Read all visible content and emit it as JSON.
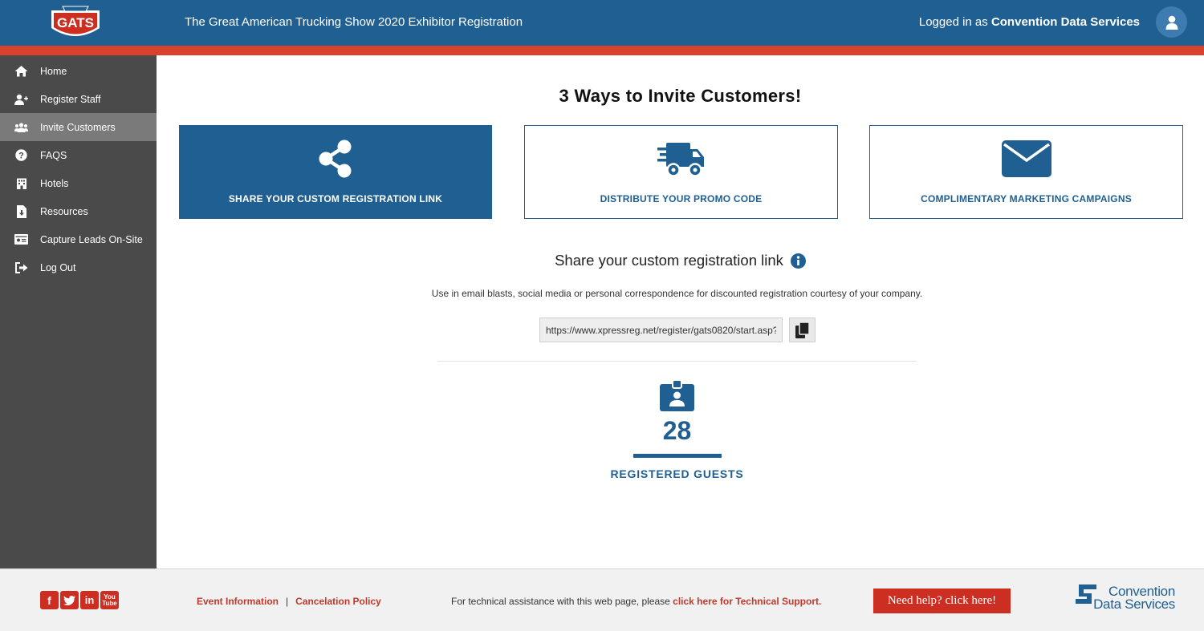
{
  "header": {
    "logo_text": "GATS",
    "title": "The Great American Trucking Show 2020 Exhibitor Registration",
    "logged_in_prefix": "Logged in as",
    "user_name": "Convention Data Services"
  },
  "sidebar": {
    "items": [
      {
        "label": "Home",
        "icon": "home-icon"
      },
      {
        "label": "Register Staff",
        "icon": "user-plus-icon"
      },
      {
        "label": "Invite Customers",
        "icon": "users-icon",
        "active": true
      },
      {
        "label": "FAQS",
        "icon": "question-circle-icon"
      },
      {
        "label": "Hotels",
        "icon": "building-icon"
      },
      {
        "label": "Resources",
        "icon": "file-download-icon"
      },
      {
        "label": "Capture Leads On-Site",
        "icon": "id-card-icon"
      },
      {
        "label": "Log Out",
        "icon": "sign-out-icon"
      }
    ]
  },
  "main": {
    "title": "3 Ways to Invite Customers!",
    "cards": [
      {
        "label": "SHARE YOUR CUSTOM REGISTRATION LINK",
        "icon": "share-icon",
        "selected": true
      },
      {
        "label": "DISTRIBUTE YOUR PROMO CODE",
        "icon": "truck-icon",
        "selected": false
      },
      {
        "label": "COMPLIMENTARY MARKETING CAMPAIGNS",
        "icon": "envelope-icon",
        "selected": false
      }
    ],
    "section_title": "Share your custom registration link",
    "section_desc": "Use in email blasts, social media or personal correspondence for discounted registration courtesy of your company.",
    "link_value": "https://www.xpressreg.net/register/gats0820/start.asp?",
    "registered_count": "28",
    "registered_label": "REGISTERED GUESTS"
  },
  "footer": {
    "event_info": "Event Information",
    "separator": "|",
    "cancel_policy": "Cancelation Policy",
    "support_prefix": "For technical assistance with this web page, please",
    "support_link": "click here for Technical Support.",
    "help_button": "Need help? click here!",
    "cds_line1": "Convention",
    "cds_line2": "Data Services"
  },
  "colors": {
    "brand_blue": "#1f5f92",
    "accent_red": "#d9412e",
    "sidebar_bg": "#4a4a4a"
  }
}
